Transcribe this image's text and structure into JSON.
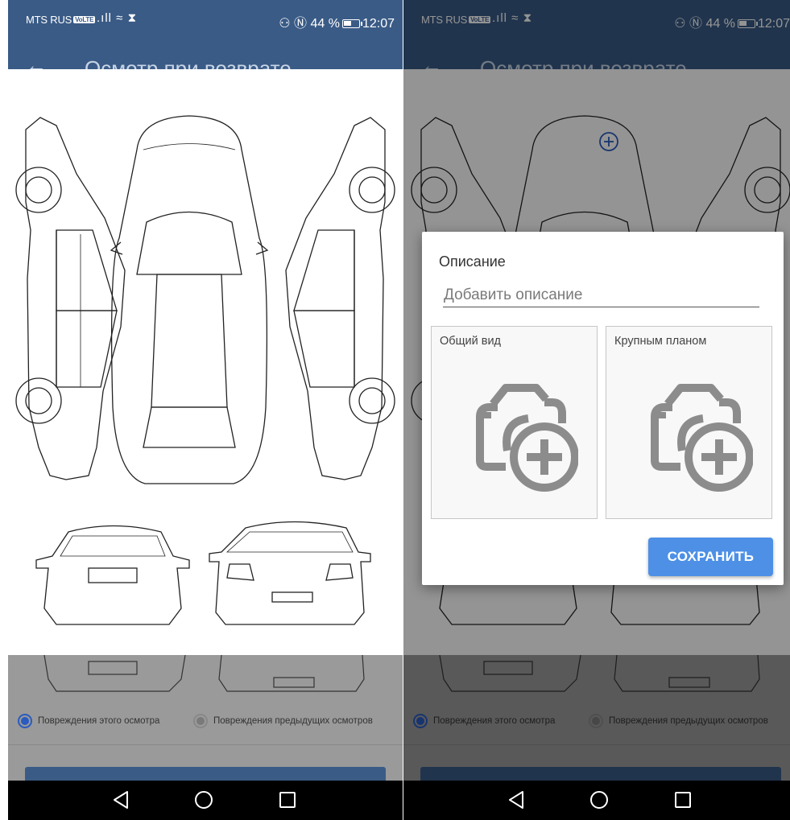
{
  "left": {
    "status": {
      "carrier": "MTS RUS",
      "volte": "VoLTE",
      "signal": ".ıll ≈ ⧗",
      "right": "⚇ Ⓝ 44 %",
      "time": "12:07"
    },
    "appbar": {
      "back": "←",
      "title": "Осмотр при возврате"
    },
    "radios": {
      "current": "Повреждения этого осмотра",
      "previous": "Повреждения предыдущих осмотров"
    },
    "nav": {
      "back": "◁",
      "home": "○",
      "recents": "□"
    }
  },
  "right": {
    "status": {
      "carrier": "MTS RUS",
      "volte": "VoLTE",
      "signal": ".ıll ≈ ⧗",
      "right": "⚇ Ⓝ 44 %",
      "time": "12:07"
    },
    "appbar": {
      "back": "←",
      "title": "Осмотр при возврате"
    },
    "radios": {
      "current": "Повреждения этого осмотра",
      "previous": "Повреждения предыдущих осмотров"
    },
    "dialog": {
      "description_label": "Описание",
      "description_placeholder": "Добавить описание",
      "general_view_label": "Общий вид",
      "close_up_label": "Крупным планом",
      "save_label": "СОХРАНИТЬ"
    },
    "nav": {
      "back": "◁",
      "home": "○",
      "recents": "□"
    }
  },
  "colors": {
    "appbar": "#3a5b86",
    "accent": "#4d90e6",
    "radio_selected": "#2a5bbf",
    "navbar": "#000000"
  },
  "icons": [
    "back-arrow-icon",
    "add-damage-icon",
    "camera-add-icon",
    "nav-back-icon",
    "nav-home-icon",
    "nav-recents-icon"
  ]
}
